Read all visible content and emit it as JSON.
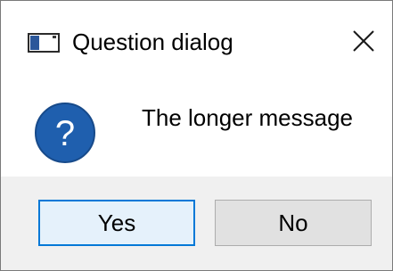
{
  "window": {
    "title": "Question dialog",
    "app_icon": "window-app-icon",
    "close_icon": "close-icon"
  },
  "dialog": {
    "icon": "question-icon",
    "icon_color": "#1f5fae",
    "message": "The longer message"
  },
  "buttons": {
    "yes_label": "Yes",
    "no_label": "No",
    "default": "yes",
    "accent_color": "#0078d7"
  }
}
